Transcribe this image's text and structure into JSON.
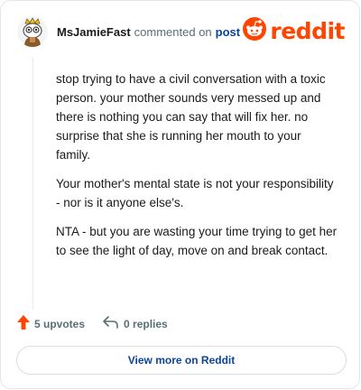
{
  "header": {
    "username": "MsJamieFast",
    "action_text": "commented on",
    "post_link": "post",
    "brand": "reddit"
  },
  "comment": {
    "paragraphs": [
      "stop trying to have a civil conversation with a toxic person. your mother sounds very messed up and there is nothing you can say that will fix her. no surprise that she is running her mouth to your family.",
      "Your mother's mental state is not your responsibility - nor is it anyone else's.",
      "NTA - but you are wasting your time trying to get her to see the light of day, move on and break contact."
    ]
  },
  "actions": {
    "upvotes": "5 upvotes",
    "replies": "0 replies"
  },
  "footer": {
    "view_more_label": "View more on Reddit"
  },
  "colors": {
    "brand": "#ff4500",
    "link": "#0a449b",
    "muted": "#576f76"
  },
  "icons": {
    "avatar": "snoo-avatar-icon",
    "logo": "reddit-snoo-icon",
    "upvote": "upvote-arrow-icon",
    "reply": "reply-arrow-icon"
  }
}
